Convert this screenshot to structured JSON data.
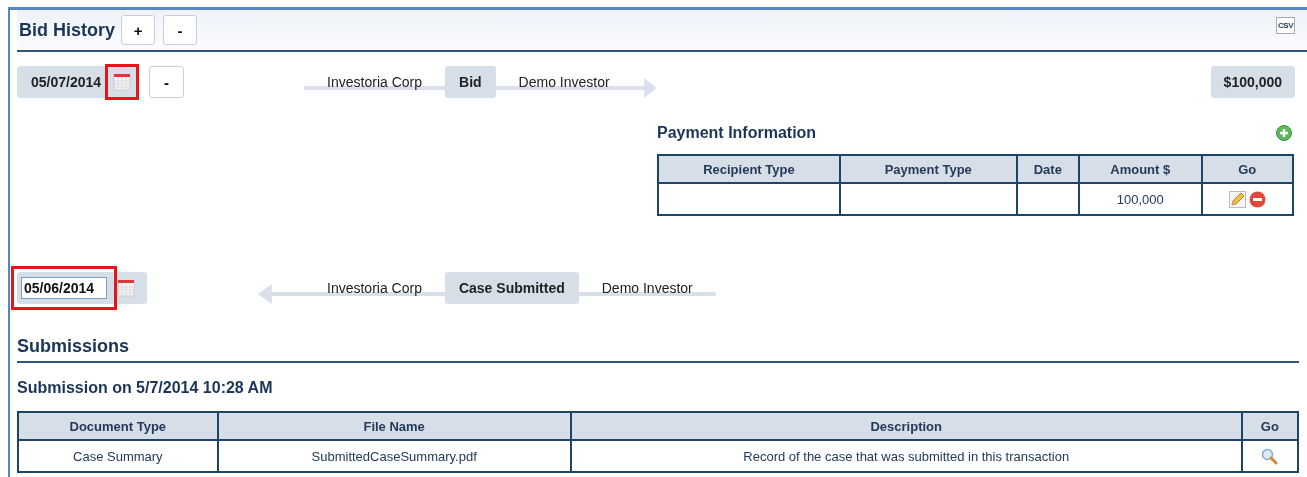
{
  "panel": {
    "title": "Bid History",
    "header_buttons": [
      "+",
      "-"
    ],
    "export_label": "CSV"
  },
  "events": [
    {
      "date": "05/07/2014",
      "editing": false,
      "calendar_highlighted": true,
      "date_highlighted": false,
      "remove_button": "-",
      "from": "Investoria Corp",
      "action": "Bid",
      "to": "Demo Investor",
      "reversed": false,
      "amount": "$100,000"
    },
    {
      "date": "05/06/2014",
      "editing": true,
      "calendar_highlighted": false,
      "date_highlighted": true,
      "from": "Investoria Corp",
      "action": "Case Submitted",
      "to": "Demo Investor",
      "reversed": true
    }
  ],
  "payment_information": {
    "title": "Payment Information",
    "columns": [
      "Recipient Type",
      "Payment Type",
      "Date",
      "Amount $",
      "Go"
    ],
    "rows": [
      {
        "cells": [
          null,
          null,
          null,
          "100,000"
        ]
      }
    ]
  },
  "submissions": {
    "title": "Submissions",
    "subtitle": "Submission on 5/7/2014 10:28 AM",
    "columns": [
      "Document Type",
      "File Name",
      "Description",
      "Go"
    ],
    "rows": [
      {
        "cells": [
          "Case Summary",
          "SubmittedCaseSummary.pdf",
          "Record of the case that was submitted in this transaction"
        ]
      }
    ]
  }
}
